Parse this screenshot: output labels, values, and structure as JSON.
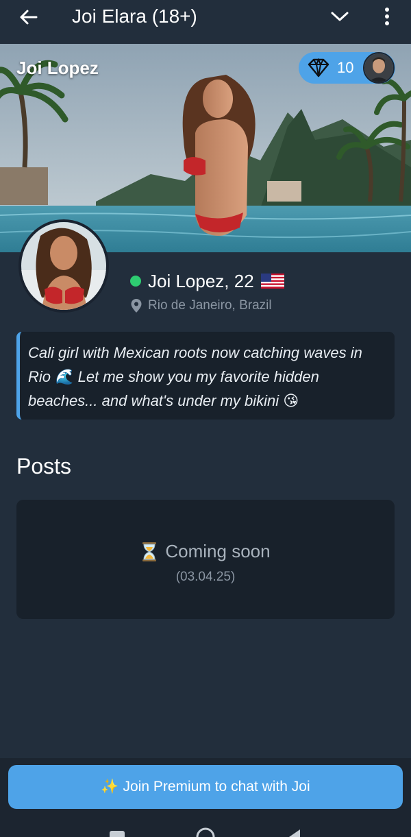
{
  "header": {
    "title": "Joi Elara (18+)",
    "back_icon": "arrow-left-icon",
    "dropdown_icon": "chevron-down-icon",
    "menu_icon": "more-vertical-icon"
  },
  "hero": {
    "name": "Joi Lopez",
    "gems": "10",
    "gem_icon": "diamond-icon"
  },
  "profile": {
    "name_age": "Joi Lopez, 22",
    "online": true,
    "online_color": "#2ecc71",
    "flag": "us-flag-icon",
    "location": "Rio de Janeiro, Brazil"
  },
  "bio": {
    "text": "Cali girl with Mexican roots now catching waves in Rio 🌊 Let me show you my favorite hidden beaches... and what's under my bikini 😘"
  },
  "posts": {
    "heading": "Posts",
    "status": "Coming soon",
    "date": "(03.04.25)"
  },
  "cta": {
    "label": "Join Premium to chat with Joi",
    "icon": "✨"
  },
  "colors": {
    "background": "#222e3c",
    "card": "#18212b",
    "accent": "#4ea3e8"
  }
}
